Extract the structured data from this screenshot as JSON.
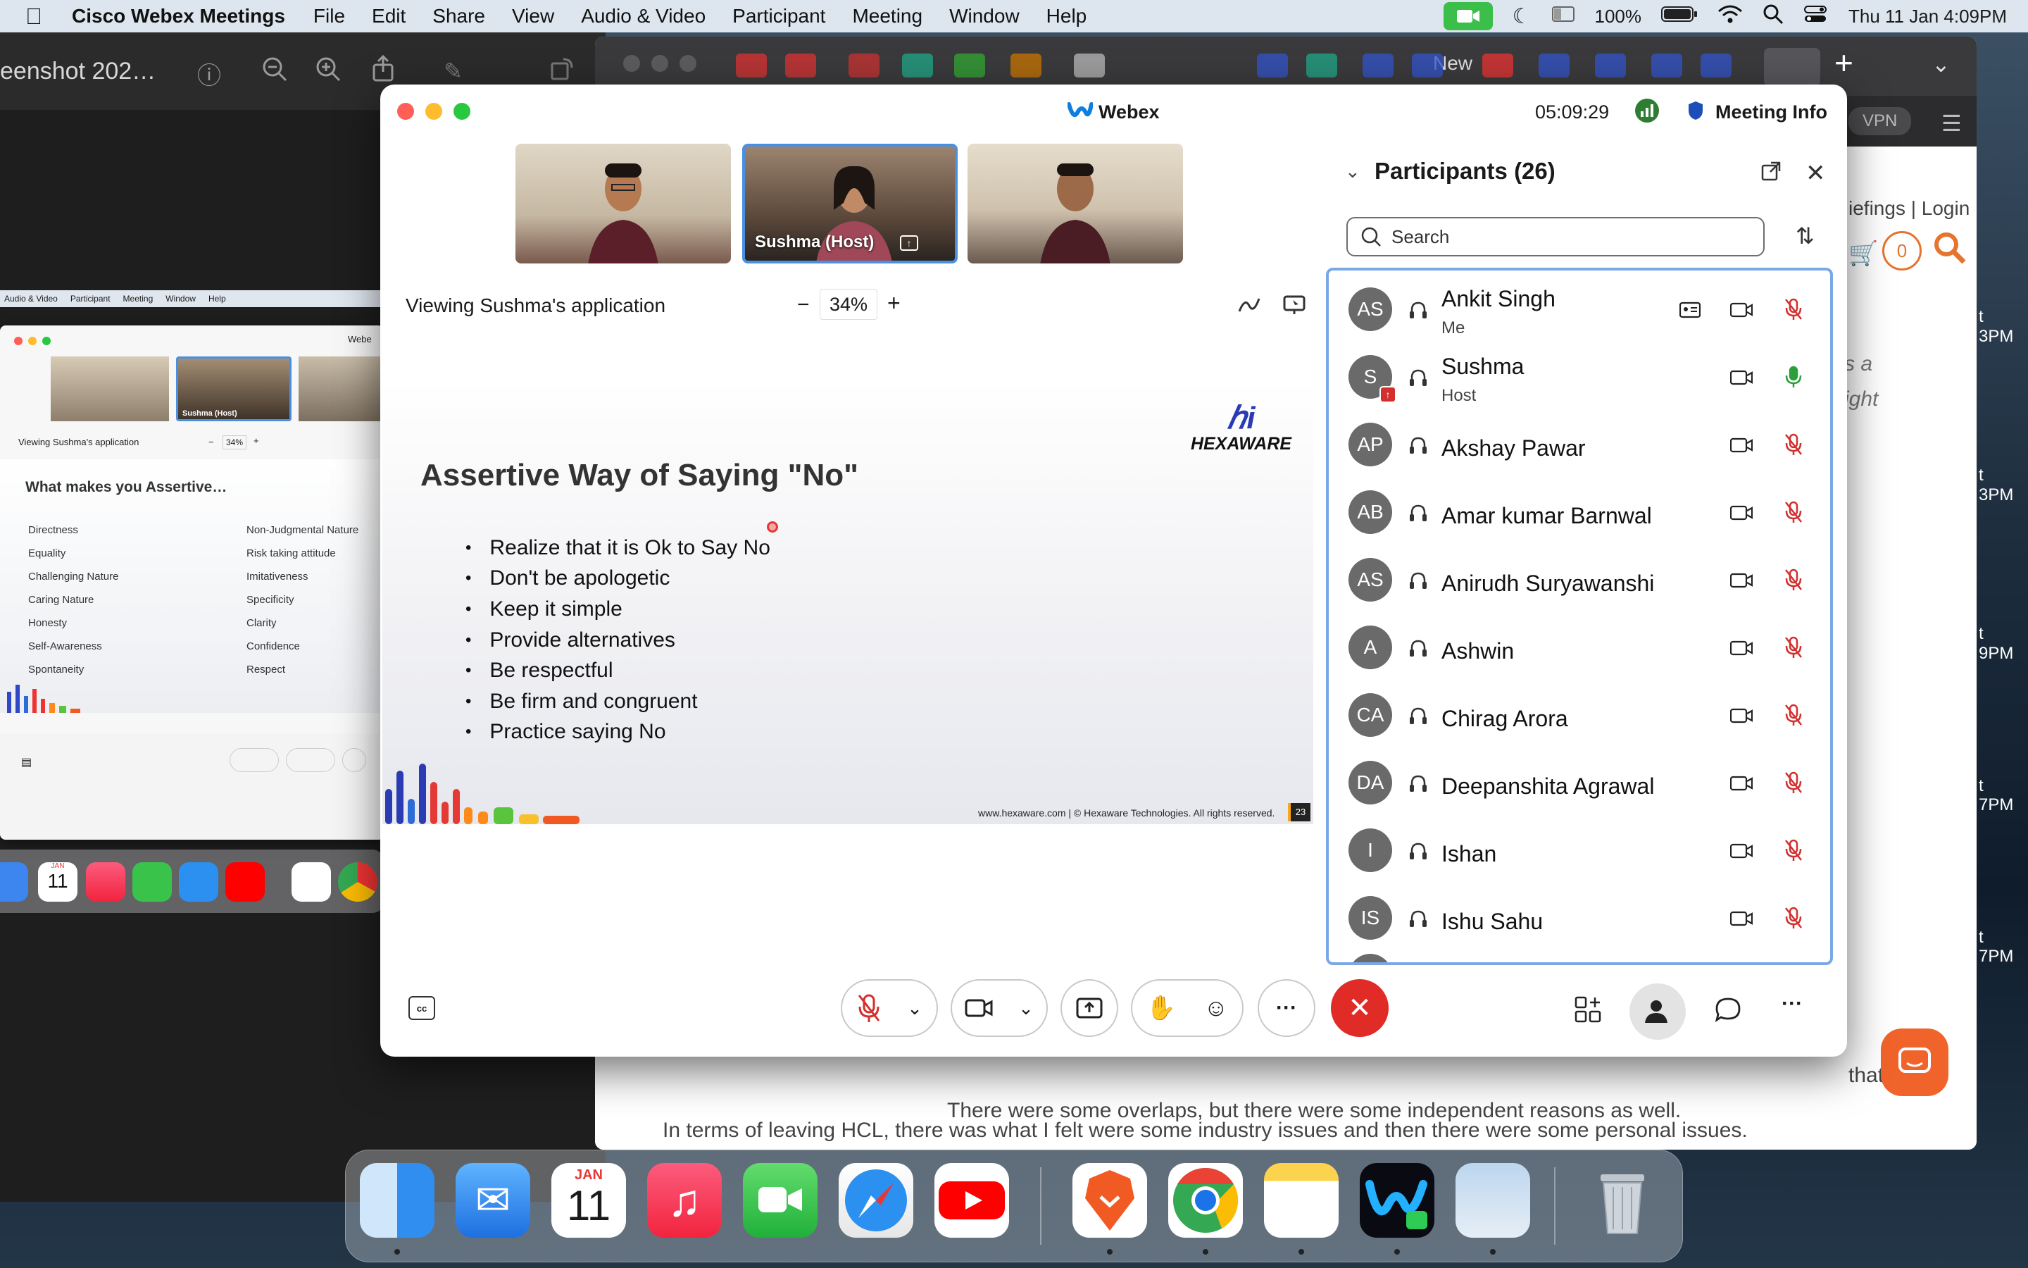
{
  "menubar": {
    "app": "Cisco Webex Meetings",
    "items": [
      "File",
      "Edit",
      "Share",
      "View",
      "Audio & Video",
      "Participant",
      "Meeting",
      "Window",
      "Help"
    ],
    "battery": "100%",
    "datetime": "Thu 11 Jan  4:09PM"
  },
  "preview": {
    "title": "eenshot 202…"
  },
  "browser": {
    "new_tab_label": "New",
    "vpn": "VPN",
    "nav_links": "iefings | Login",
    "cart_count": "0",
    "side_times": [
      "t",
      "3PM",
      "t",
      "3PM",
      "t",
      "9PM",
      "t",
      "7PM",
      "t",
      "7PM"
    ],
    "italic_fragments": [
      "s a",
      "ight"
    ],
    "para1": "There were some overlaps, but there were some independent reasons as well.",
    "para2": "In terms of leaving HCL, there was what I felt were some industry issues and then there were some personal issues.",
    "para0_tail": "that I"
  },
  "mini": {
    "menu": [
      "Audio & Video",
      "Participant",
      "Meeting",
      "Window",
      "Help"
    ],
    "app": "Webe",
    "host_label": "Sushma  (Host)",
    "viewing": "Viewing Sushma's application",
    "zoom": "34%",
    "slide_title": "What makes you Assertive…",
    "col1": [
      "Directness",
      "Equality",
      "Challenging Nature",
      "Caring Nature",
      "Honesty",
      "Self-Awareness",
      "Spontaneity"
    ],
    "col2": [
      "Non-Judgmental Nature",
      "Risk taking attitude",
      "Imitativeness",
      "Specificity",
      "Clarity",
      "Confidence",
      "Respect"
    ]
  },
  "webex": {
    "title": "Webex",
    "timer": "05:09:29",
    "meeting_info": "Meeting Info",
    "host_tile": "Sushma  (Host)",
    "viewing": "Viewing Sushma's application",
    "zoom": "34%",
    "zoom_minus": "−",
    "zoom_plus": "+"
  },
  "slide": {
    "title": "Assertive Way of Saying \"No\"",
    "logo": "HEXAWARE",
    "logo_mark": "ℎi",
    "bullets": [
      "Realize that it is Ok to Say No",
      "Don't be apologetic",
      "Keep it simple",
      "Provide alternatives",
      "Be respectful",
      "Be firm and congruent",
      "Practice saying No"
    ],
    "footer": "www.hexaware.com  | © Hexaware Technologies. All rights reserved.",
    "page": "23"
  },
  "participants": {
    "header": "Participants (26)",
    "search_placeholder": "Search",
    "list": [
      {
        "initials": "AS",
        "name": "Ankit Singh",
        "role": "Me",
        "mic": "muted"
      },
      {
        "initials": "S",
        "name": "Sushma",
        "role": "Host",
        "mic": "on"
      },
      {
        "initials": "AP",
        "name": "Akshay Pawar",
        "role": "",
        "mic": "muted"
      },
      {
        "initials": "AB",
        "name": "Amar kumar Barnwal",
        "role": "",
        "mic": "muted"
      },
      {
        "initials": "AS",
        "name": "Anirudh Suryawanshi",
        "role": "",
        "mic": "muted"
      },
      {
        "initials": "A",
        "name": "Ashwin",
        "role": "",
        "mic": "muted"
      },
      {
        "initials": "CA",
        "name": "Chirag Arora",
        "role": "",
        "mic": "muted"
      },
      {
        "initials": "DA",
        "name": "Deepanshita Agrawal",
        "role": "",
        "mic": "muted"
      },
      {
        "initials": "I",
        "name": "Ishan",
        "role": "",
        "mic": "muted"
      },
      {
        "initials": "IS",
        "name": "Ishu Sahu",
        "role": "",
        "mic": "muted"
      }
    ]
  },
  "dock": {
    "calendar_month": "JAN",
    "calendar_day": "11",
    "mini_month": "JAN",
    "mini_day": "11"
  },
  "colors": {
    "accent": "#1170cf",
    "end_call": "#e02b27",
    "hexaware_orange": "#f05a22",
    "mic_on": "#2e9e3c",
    "selection": "#7aa7e6"
  }
}
